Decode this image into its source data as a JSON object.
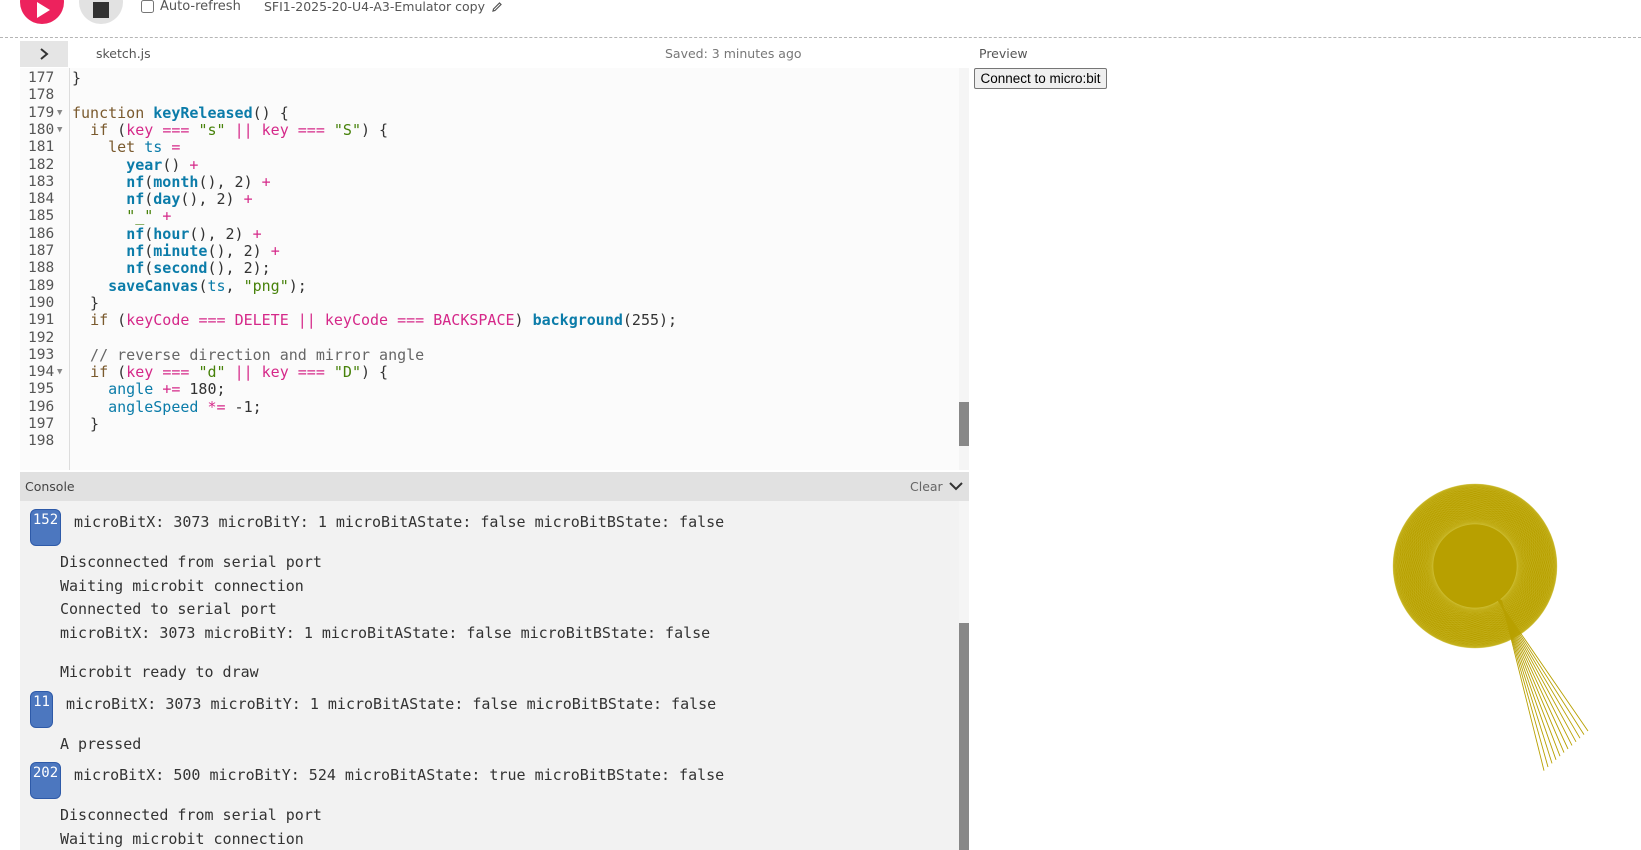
{
  "toolbar": {
    "auto_refresh_label": "Auto-refresh",
    "auto_refresh_checked": false,
    "project_name": "SFI1-2025-20-U4-A3-Emulator copy"
  },
  "editor": {
    "file_name": "sketch.js",
    "saved_status": "Saved: 3 minutes ago",
    "lines": [
      {
        "num": "177",
        "text": "}"
      },
      {
        "num": "178",
        "text": ""
      },
      {
        "num": "179",
        "text": "function keyReleased() {",
        "fold": true
      },
      {
        "num": "180",
        "text": "  if (key === \"s\" || key === \"S\") {",
        "fold": true
      },
      {
        "num": "181",
        "text": "    let ts ="
      },
      {
        "num": "182",
        "text": "      year() +"
      },
      {
        "num": "183",
        "text": "      nf(month(), 2) +"
      },
      {
        "num": "184",
        "text": "      nf(day(), 2) +"
      },
      {
        "num": "185",
        "text": "      \"_\" +"
      },
      {
        "num": "186",
        "text": "      nf(hour(), 2) +"
      },
      {
        "num": "187",
        "text": "      nf(minute(), 2) +"
      },
      {
        "num": "188",
        "text": "      nf(second(), 2);"
      },
      {
        "num": "189",
        "text": "    saveCanvas(ts, \"png\");"
      },
      {
        "num": "190",
        "text": "  }"
      },
      {
        "num": "191",
        "text": "  if (keyCode === DELETE || keyCode === BACKSPACE) background(255);"
      },
      {
        "num": "192",
        "text": ""
      },
      {
        "num": "193",
        "text": "  // reverse direction and mirror angle"
      },
      {
        "num": "194",
        "text": "  if (key === \"d\" || key === \"D\") {",
        "fold": true
      },
      {
        "num": "195",
        "text": "    angle += 180;"
      },
      {
        "num": "196",
        "text": "    angleSpeed *= -1;"
      },
      {
        "num": "197",
        "text": "  }"
      },
      {
        "num": "198",
        "text": ""
      }
    ]
  },
  "console": {
    "title": "Console",
    "clear_label": "Clear",
    "entries": [
      {
        "count": "152",
        "text": "microBitX: 3073 microBitY: 1 microBitAState: false microBitBState: false"
      },
      {
        "text": "Disconnected from serial port"
      },
      {
        "text": "Waiting microbit connection"
      },
      {
        "text": "Connected to serial port"
      },
      {
        "text": "microBitX: 3073 microBitY: 1 microBitAState: false microBitBState: false"
      },
      {
        "text": "Microbit ready to draw"
      },
      {
        "count": "11",
        "text": "microBitX: 3073 microBitY: 1 microBitAState: false microBitBState: false"
      },
      {
        "text": "A pressed"
      },
      {
        "count": "202",
        "text": "microBitX: 500 microBitY: 524 microBitAState: true microBitBState: false"
      },
      {
        "text": "Disconnected from serial port"
      },
      {
        "text": "Waiting microbit connection"
      }
    ]
  },
  "preview": {
    "label": "Preview",
    "connect_button": "Connect to micro:bit",
    "drawing_color": "#b8a000"
  }
}
